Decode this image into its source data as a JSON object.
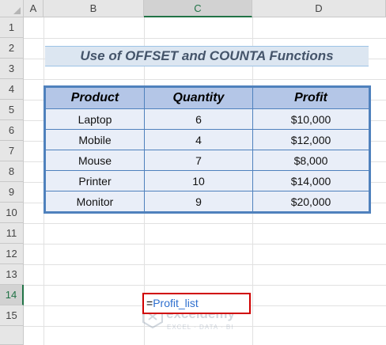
{
  "columns": [
    "A",
    "B",
    "C",
    "D"
  ],
  "selected_column": "C",
  "rows": [
    "1",
    "2",
    "3",
    "4",
    "5",
    "6",
    "7",
    "8",
    "9",
    "10",
    "11",
    "12",
    "13",
    "14",
    "15"
  ],
  "selected_row": "14",
  "title": "Use of OFFSET and COUNTA Functions",
  "table": {
    "headers": [
      "Product",
      "Quantity",
      "Profit"
    ],
    "rows": [
      [
        "Laptop",
        "6",
        "$10,000"
      ],
      [
        "Mobile",
        "4",
        "$12,000"
      ],
      [
        "Mouse",
        "7",
        "$8,000"
      ],
      [
        "Printer",
        "10",
        "$14,000"
      ],
      [
        "Monitor",
        "9",
        "$20,000"
      ]
    ]
  },
  "formula_cell": {
    "prefix": "=",
    "reference": "Profit_list"
  },
  "watermark": {
    "name": "exceldemy",
    "tagline": "EXCEL · DATA · BI"
  },
  "colors": {
    "title_bg": "#dce6f1",
    "header_bg": "#b4c6e7",
    "cell_bg": "#e9eef8",
    "table_border": "#4f81bd",
    "selection_border": "#d00000",
    "excel_green": "#217346"
  }
}
